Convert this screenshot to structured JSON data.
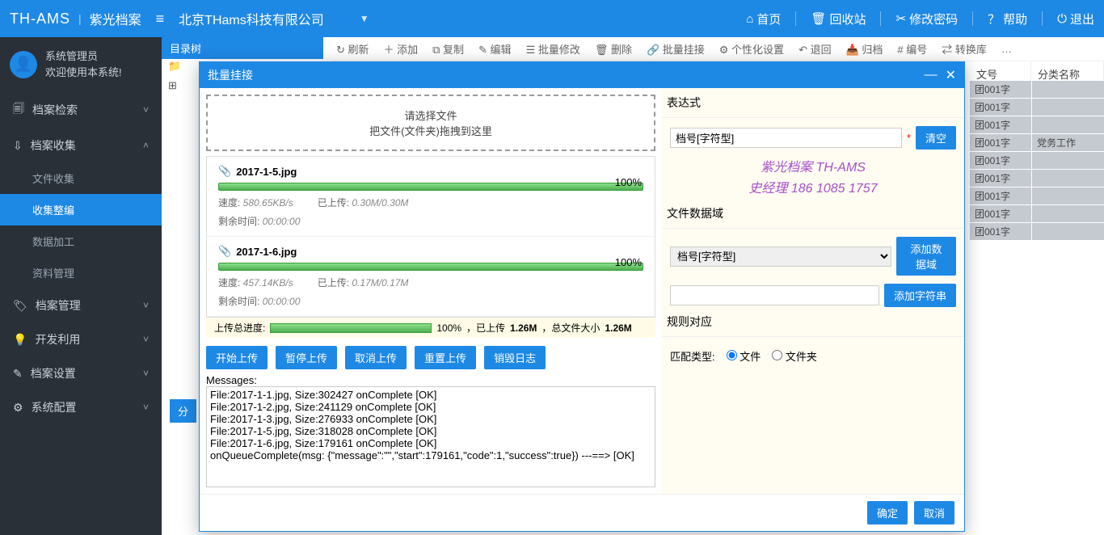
{
  "header": {
    "logo": "TH-AMS",
    "logo_sub": "紫光档案",
    "company": "北京THams科技有限公司",
    "nav": {
      "home": "首页",
      "recycle": "回收站",
      "pwd": "修改密码",
      "help": "帮助",
      "logout": "退出"
    }
  },
  "user": {
    "name": "系统管理员",
    "welcome": "欢迎使用本系统!"
  },
  "sidebar": {
    "items": [
      {
        "label": "档案检索",
        "icon": "🗐"
      },
      {
        "label": "档案收集",
        "icon": "⇩",
        "open": true,
        "children": [
          "文件收集",
          "收集整编",
          "数据加工",
          "资料管理"
        ]
      },
      {
        "label": "档案管理",
        "icon": "🏷"
      },
      {
        "label": "开发利用",
        "icon": "💡"
      },
      {
        "label": "档案设置",
        "icon": "✎"
      },
      {
        "label": "系统配置",
        "icon": "⚙"
      }
    ],
    "active_child": "收集整编"
  },
  "tree": {
    "title": "目录树"
  },
  "toolbar": [
    "刷新",
    "添加",
    "复制",
    "编辑",
    "批量修改",
    "删除",
    "批量挂接",
    "个性化设置",
    "退回",
    "归档",
    "编号",
    "转换库"
  ],
  "table": {
    "headers": [
      "文号",
      "分类名称"
    ],
    "rows": [
      {
        "c1": "团001字",
        "c2": ""
      },
      {
        "c1": "团001字",
        "c2": ""
      },
      {
        "c1": "团001字",
        "c2": ""
      },
      {
        "c1": "团001字",
        "c2": "党务工作"
      },
      {
        "c1": "团001字",
        "c2": ""
      },
      {
        "c1": "团001字",
        "c2": ""
      },
      {
        "c1": "团001字",
        "c2": ""
      },
      {
        "c1": "团001字",
        "c2": ""
      },
      {
        "c1": "团001字",
        "c2": ""
      }
    ]
  },
  "tab_label": "分",
  "modal": {
    "title": "批量挂接",
    "dropzone": {
      "l1": "请选择文件",
      "l2": "把文件(文件夹)拖拽到这里"
    },
    "files": [
      {
        "name": "2017-1-5.jpg",
        "pct": "100%",
        "speed": "580.65KB/s",
        "uploaded": "0.30M/0.30M",
        "remain": "00:00:00"
      },
      {
        "name": "2017-1-6.jpg",
        "pct": "100%",
        "speed": "457.14KB/s",
        "uploaded": "0.17M/0.17M",
        "remain": "00:00:00"
      }
    ],
    "labels": {
      "speed": "速度:",
      "uploaded": "已上传:",
      "remain": "剩余时间:"
    },
    "total": {
      "label": "上传总进度:",
      "pct": "100%",
      "uploaded_label": "，已上传",
      "uploaded": "1.26M",
      "total_label": "，总文件大小",
      "total": "1.26M"
    },
    "buttons": {
      "start": "开始上传",
      "pause": "暂停上传",
      "cancel": "取消上传",
      "reset": "重置上传",
      "destroy": "销毁日志"
    },
    "messages_label": "Messages:",
    "messages": [
      "File:2017-1-1.jpg, Size:302427 onComplete [OK]",
      "File:2017-1-2.jpg, Size:241129 onComplete [OK]",
      "File:2017-1-3.jpg, Size:276933 onComplete [OK]",
      "File:2017-1-5.jpg, Size:318028 onComplete [OK]",
      "File:2017-1-6.jpg, Size:179161 onComplete [OK]",
      "onQueueComplete(msg: {\"message\":\"\",\"start\":179161,\"code\":1,\"success\":true}) ---==> [OK]"
    ],
    "right": {
      "expr_title": "表达式",
      "expr_value": "档号[字符型]",
      "clear": "清空",
      "watermark1": "紫光档案 TH-AMS",
      "watermark2": "史经理  186 1085 1757",
      "data_title": "文件数据域",
      "select_value": "档号[字符型]",
      "add_domain": "添加数据域",
      "add_string": "添加字符串",
      "rule_title": "规则对应",
      "match_label": "匹配类型:",
      "opt_file": "文件",
      "opt_folder": "文件夹"
    },
    "footer": {
      "ok": "确定",
      "cancel": "取消"
    }
  }
}
